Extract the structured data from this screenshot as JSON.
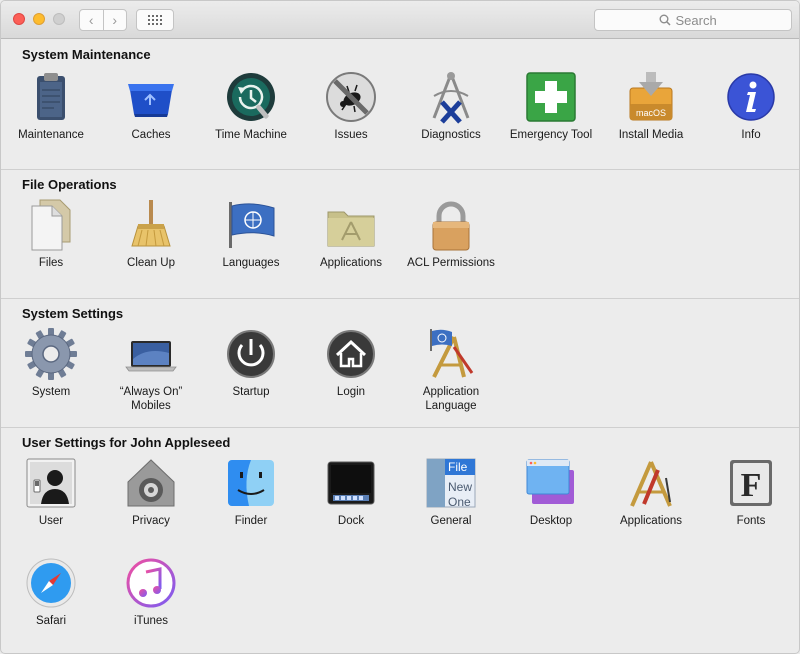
{
  "toolbar": {
    "back_glyph": "‹",
    "forward_glyph": "›",
    "search_placeholder": "Search"
  },
  "sections": {
    "maintenance": {
      "title": "System Maintenance",
      "items": [
        "Maintenance",
        "Caches",
        "Time Machine",
        "Issues",
        "Diagnostics",
        "Emergency Tool",
        "Install Media",
        "Info"
      ]
    },
    "file_ops": {
      "title": "File Operations",
      "items": [
        "Files",
        "Clean Up",
        "Languages",
        "Applications",
        "ACL Permissions"
      ]
    },
    "system_settings": {
      "title": "System Settings",
      "items": [
        "System",
        "“Always On”\nMobiles",
        "Startup",
        "Login",
        "Application\nLanguage"
      ]
    },
    "user_settings": {
      "title": "User Settings for John Appleseed",
      "items": [
        "User",
        "Privacy",
        "Finder",
        "Dock",
        "General",
        "Desktop",
        "Applications",
        "Fonts",
        "Safari",
        "iTunes"
      ]
    }
  },
  "icon_text": {
    "install_media": "macOS",
    "general": [
      "File",
      "New",
      "One"
    ],
    "fonts": "F"
  },
  "colors": {
    "window_bg": "#ececec",
    "accent_blue": "#3b6bd6",
    "emergency_green": "#3aa546"
  }
}
